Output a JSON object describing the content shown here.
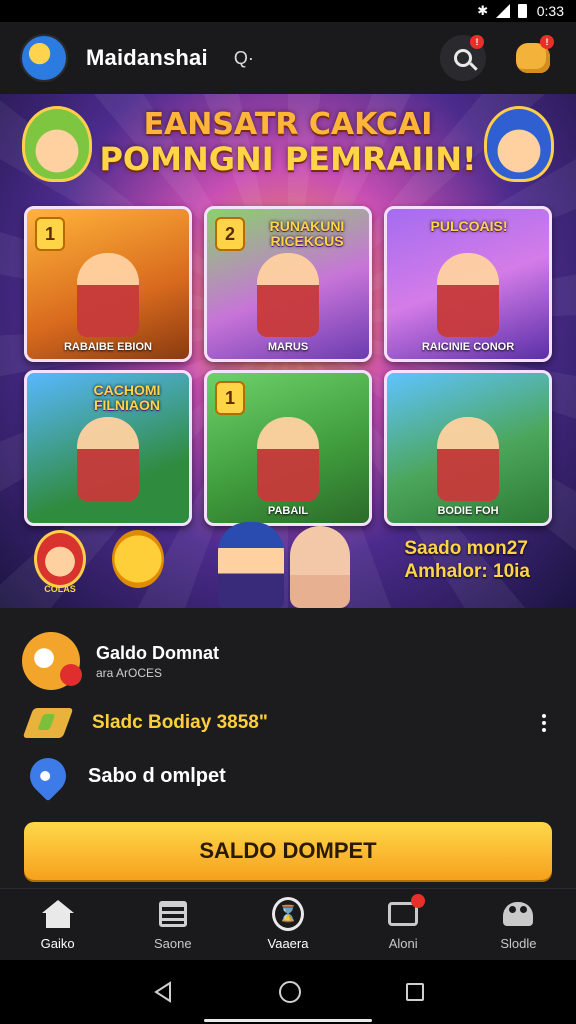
{
  "status_bar": {
    "time": "0:33"
  },
  "header": {
    "title": "Maidanshai",
    "title_icon": "Q·"
  },
  "banner": {
    "title_line1": "EANSATR CAKCAI",
    "title_line2": "POMNGNI PEMRAIIN!",
    "tiles": [
      {
        "badge": "1",
        "head": "",
        "caption": "RABAIBE EBION"
      },
      {
        "badge": "2",
        "head": "RUNAKUNI RICEKCUS",
        "caption": "MARUS"
      },
      {
        "badge": "",
        "head": "PULCOAIS!",
        "caption": "RAICINIE CONOR"
      },
      {
        "badge": "",
        "head": "CACHOMI FILNIAON",
        "caption": ""
      },
      {
        "badge": "1",
        "head": "",
        "caption": "PABAIL"
      },
      {
        "badge": "",
        "head": "",
        "caption": "BODIE FOH"
      }
    ],
    "char_label": "COLAS",
    "info_line1": "Saado mon27",
    "info_line2": "Amhalor: 10ia"
  },
  "wallet": {
    "item1_title": "Galdo Domnat",
    "item1_sub": "ara ArOCES",
    "item2_text": "Sladc Bodiay 3858\"",
    "item3_text": "Sabo d omlpet",
    "cta_label": "SALDO DOMPET"
  },
  "bottom_nav": {
    "items": [
      {
        "label": "Gaiko"
      },
      {
        "label": "Saone"
      },
      {
        "label": "Vaaera"
      },
      {
        "label": "Aloni"
      },
      {
        "label": "Slodle"
      }
    ]
  },
  "colors": {
    "accent": "#ffcf3a",
    "badge": "#e8302a",
    "panel": "#1c1c1f",
    "cta_top": "#ffd84a",
    "cta_bottom": "#f6a11d"
  },
  "icons": {
    "status": [
      "bluetooth-icon",
      "signal-icon",
      "battery-icon"
    ],
    "header": [
      "app-logo-icon",
      "search-icon",
      "puzzle-icon"
    ],
    "nav": [
      "home-icon",
      "list-icon",
      "compass-icon",
      "camera-icon",
      "people-icon"
    ]
  }
}
